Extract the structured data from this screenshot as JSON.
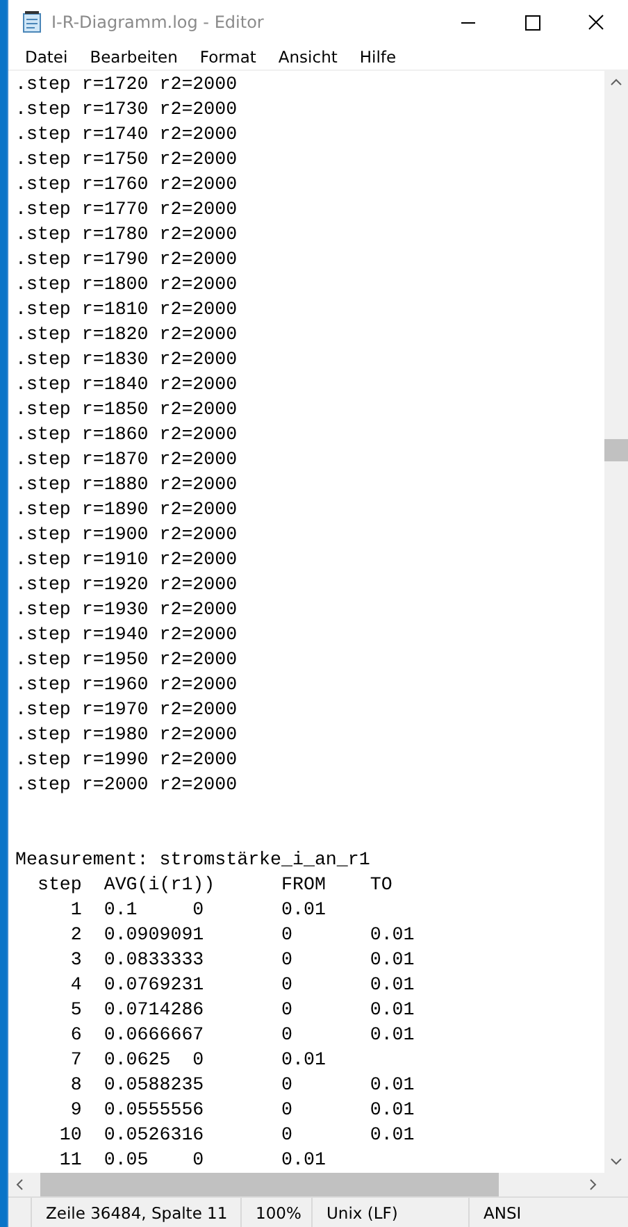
{
  "window": {
    "title": "I-R-Diagramm.log - Editor"
  },
  "menu": [
    "Datei",
    "Bearbeiten",
    "Format",
    "Ansicht",
    "Hilfe"
  ],
  "lines": [
    ".step r=1720 r2=2000",
    ".step r=1730 r2=2000",
    ".step r=1740 r2=2000",
    ".step r=1750 r2=2000",
    ".step r=1760 r2=2000",
    ".step r=1770 r2=2000",
    ".step r=1780 r2=2000",
    ".step r=1790 r2=2000",
    ".step r=1800 r2=2000",
    ".step r=1810 r2=2000",
    ".step r=1820 r2=2000",
    ".step r=1830 r2=2000",
    ".step r=1840 r2=2000",
    ".step r=1850 r2=2000",
    ".step r=1860 r2=2000",
    ".step r=1870 r2=2000",
    ".step r=1880 r2=2000",
    ".step r=1890 r2=2000",
    ".step r=1900 r2=2000",
    ".step r=1910 r2=2000",
    ".step r=1920 r2=2000",
    ".step r=1930 r2=2000",
    ".step r=1940 r2=2000",
    ".step r=1950 r2=2000",
    ".step r=1960 r2=2000",
    ".step r=1970 r2=2000",
    ".step r=1980 r2=2000",
    ".step r=1990 r2=2000",
    ".step r=2000 r2=2000"
  ],
  "measurement_lines": [
    "Measurement: stromstärke_i_an_r1",
    "  step  AVG(i(r1))      FROM    TO",
    "     1  0.1     0       0.01",
    "     2  0.0909091       0       0.01",
    "     3  0.0833333       0       0.01",
    "     4  0.0769231       0       0.01",
    "     5  0.0714286       0       0.01",
    "     6  0.0666667       0       0.01",
    "     7  0.0625  0       0.01",
    "     8  0.0588235       0       0.01",
    "     9  0.0555556       0       0.01",
    "    10  0.0526316       0       0.01",
    "    11  0.05    0       0.01"
  ],
  "status_bar": {
    "position": "Zeile 36484, Spalte 11",
    "zoom": "100%",
    "line_ending": "Unix (LF)",
    "encoding": "ANSI"
  }
}
